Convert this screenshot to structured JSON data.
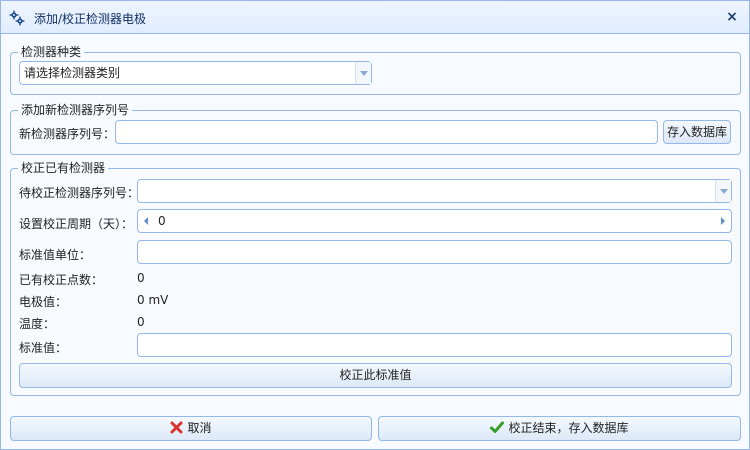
{
  "dialog": {
    "title": "添加/校正检测器电极",
    "close_symbol": "×"
  },
  "section_type": {
    "legend": "检测器种类",
    "select_value": "请选择检测器类别"
  },
  "section_add": {
    "legend": "添加新检测器序列号",
    "serial_label": "新检测器序列号：",
    "serial_value": "",
    "save_button": "存入数据库"
  },
  "section_calibrate": {
    "legend": "校正已有检测器",
    "pending_serial_label": "待校正检测器序列号：",
    "pending_serial_value": "",
    "period_label": "设置校正周期（天）：",
    "period_value": "0",
    "std_unit_label": "标准值单位：",
    "std_unit_value": "",
    "points_label": "已有校正点数：",
    "points_value": "0",
    "electrode_label": "电极值：",
    "electrode_value": "0 mV",
    "temp_label": "温度：",
    "temp_value": "0",
    "std_value_label": "标准值：",
    "std_value_value": "",
    "calibrate_button": "校正此标准值"
  },
  "footer": {
    "cancel_button": "取消",
    "finish_button": "校正结束，存入数据库"
  },
  "colors": {
    "border": "#95b8e7",
    "cancel_icon": "#d9312b",
    "ok_icon": "#3a9d2a"
  }
}
